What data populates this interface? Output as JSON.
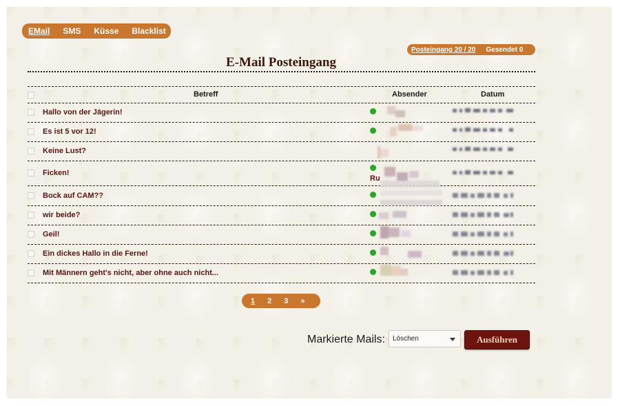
{
  "nav": {
    "items": [
      "EMail",
      "SMS",
      "Küsse",
      "Blacklist"
    ]
  },
  "folders": {
    "inbox": "Posteingang 20 / 20",
    "sent": "Gesendet 0"
  },
  "page_title": "E-Mail Posteingang",
  "table": {
    "headers": {
      "subject": "Betreff",
      "sender": "Absender",
      "date": "Datum"
    },
    "rows": [
      {
        "subject": "Hallo von der Jägerin!"
      },
      {
        "subject": "Es ist 5 vor 12!"
      },
      {
        "subject": "Keine Lust?"
      },
      {
        "subject": "Ficken!",
        "sender_fragment": "Ru"
      },
      {
        "subject": "Bock auf CAM??"
      },
      {
        "subject": "wir beide?"
      },
      {
        "subject": "Geil!"
      },
      {
        "subject": "Ein dickes Hallo in die Ferne!"
      },
      {
        "subject": "Mit Männern geht's nicht, aber ohne auch nicht..."
      }
    ]
  },
  "pagination": {
    "pages": [
      "1",
      "2",
      "3"
    ],
    "next": "»"
  },
  "bulk": {
    "label": "Markierte Mails:",
    "action_selected": "Löschen",
    "submit": "Ausführen"
  },
  "colors": {
    "accent": "#c9772f",
    "subject_text": "#5a1414",
    "button_bg": "#6e1410",
    "online": "#27a82a"
  }
}
